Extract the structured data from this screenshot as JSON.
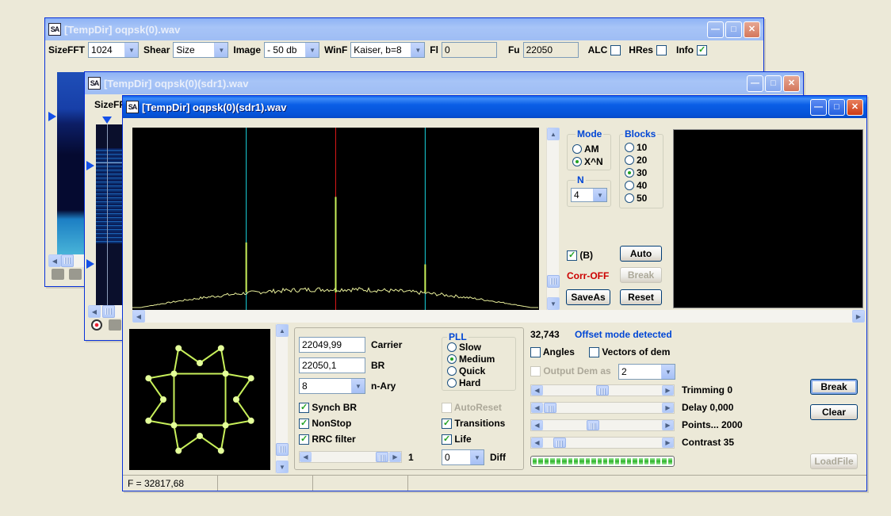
{
  "app_icon_label": "SA",
  "windows": {
    "back": {
      "title": "[TempDir] oqpsk(0).wav",
      "toolbar": {
        "sizefft_label": "SizeFFT",
        "sizefft_value": "1024",
        "shear_label": "Shear",
        "shear_value": "Size",
        "image_label": "Image",
        "image_value": "- 50 db",
        "winf_label": "WinF",
        "winf_value": "Kaiser, b=8",
        "fl_label": "Fl",
        "fl_value": "0",
        "fu_label": "Fu",
        "fu_value": "22050",
        "alc_label": "ALC",
        "alc_checked": false,
        "hres_label": "HRes",
        "hres_checked": false,
        "info_label": "Info",
        "info_checked": true
      }
    },
    "middle": {
      "title": "[TempDir] oqpsk(0)(sdr1).wav",
      "sizefft_label": "SizeFFT"
    },
    "front": {
      "title": "[TempDir] oqpsk(0)(sdr1).wav",
      "mode": {
        "label": "Mode",
        "options": [
          "AM",
          "X^N"
        ],
        "selected": "X^N"
      },
      "blocks": {
        "label": "Blocks",
        "options": [
          "10",
          "20",
          "30",
          "40",
          "50"
        ],
        "selected": "30"
      },
      "n": {
        "label": "N",
        "value": "4"
      },
      "b_checkbox_label": "(B)",
      "b_checked": true,
      "auto_label": "Auto",
      "corr_label": "Corr-OFF",
      "break_label": "Break",
      "saveas_label": "SaveAs",
      "reset_label": "Reset",
      "spectrum": {
        "markers": [
          {
            "color": "#19D6E0",
            "pos": 0.28
          },
          {
            "color": "#D81818",
            "pos": 0.5
          },
          {
            "color": "#19D6E0",
            "pos": 0.72
          }
        ],
        "peaks": [
          {
            "pos": 0.28,
            "level": 0.37
          },
          {
            "pos": 0.5,
            "level": 0.62
          },
          {
            "pos": 0.72,
            "level": 0.25
          }
        ]
      },
      "controls": {
        "carrier_value": "22049,99",
        "carrier_label": "Carrier",
        "br_value": "22050,1",
        "br_label": "BR",
        "nary_value": "8",
        "nary_label": "n-Ary",
        "pll": {
          "label": "PLL",
          "options": [
            "Slow",
            "Medium",
            "Quick",
            "Hard"
          ],
          "selected": "Medium"
        },
        "synch_br_label": "Synch BR",
        "synch_br_checked": true,
        "autoreset_label": "AutoReset",
        "autoreset_checked": false,
        "nonstop_label": "NonStop",
        "nonstop_checked": true,
        "transitions_label": "Transitions",
        "transitions_checked": true,
        "rrc_label": "RRC filter",
        "rrc_checked": true,
        "life_label": "Life",
        "life_checked": true,
        "slider_value": "1",
        "diff_value": "0",
        "diff_label": "Diff"
      },
      "right": {
        "readout": "32,743",
        "offset_text": "Offset mode detected",
        "angles_label": "Angles",
        "angles_checked": false,
        "vectors_label": "Vectors of dem",
        "vectors_checked": false,
        "output_dem_label": "Output Dem as",
        "output_dem_checked": false,
        "output_dem_value": "2",
        "trimming_label": "Trimming 0",
        "delay_label": "Delay  0,000",
        "points_label": "Points... 2000",
        "contrast_label": "Contrast 35",
        "break_label": "Break",
        "clear_label": "Clear",
        "loadfile_label": "LoadFile",
        "progress_segments": 24
      },
      "status": {
        "freq": "F = 32817,68"
      }
    }
  },
  "colors": {
    "title_active": "#0A5EEB",
    "corr_off": "#CC0000",
    "group_label": "#0046D5",
    "trace": "#E8EE9A",
    "constellation": "#C8F05A"
  }
}
